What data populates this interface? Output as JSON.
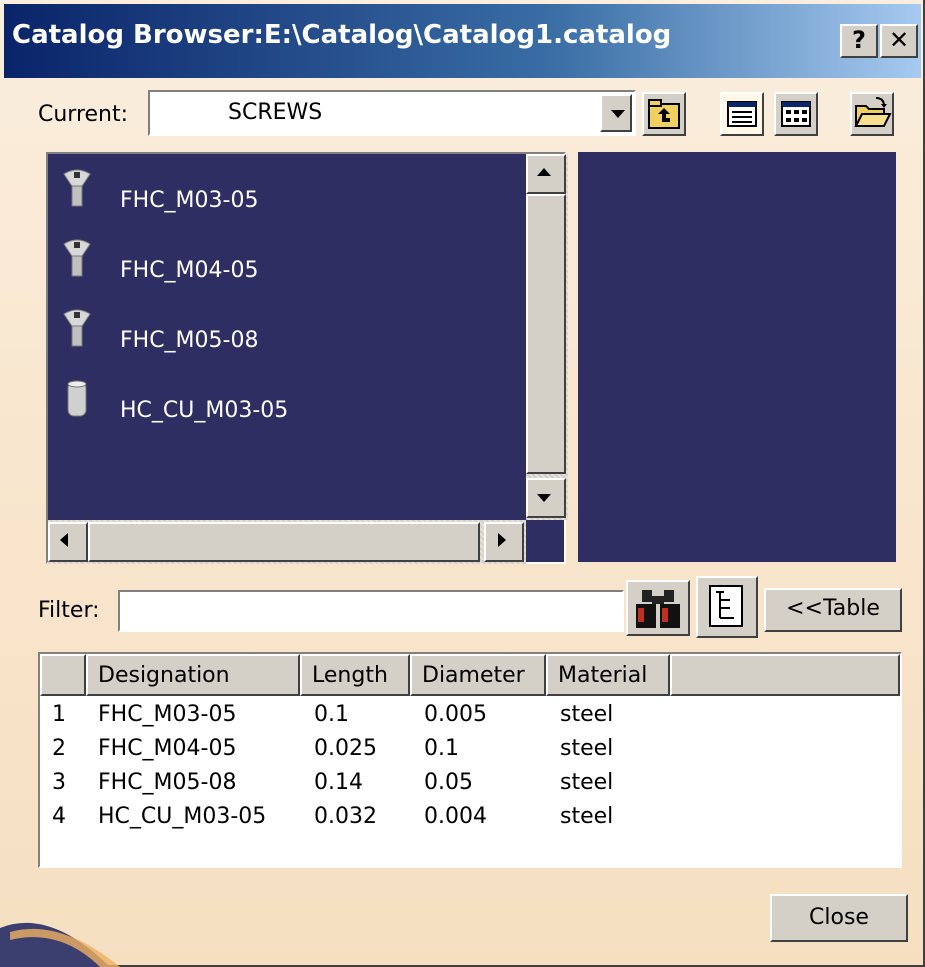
{
  "window": {
    "title": "Catalog Browser:E:\\Catalog\\Catalog1.catalog",
    "help_label": "?",
    "close_label": "✕"
  },
  "current": {
    "label": "Current:",
    "value": "SCREWS"
  },
  "icons": {
    "parent_chapter": "folder-up-icon",
    "list_view": "list-view-icon",
    "detail_view": "detail-view-icon",
    "open_catalog": "open-folder-icon",
    "search": "binoculars-icon",
    "tree": "tree-icon"
  },
  "list": {
    "items": [
      {
        "label": "FHC_M03-05",
        "icon": "screw-icon"
      },
      {
        "label": "FHC_M04-05",
        "icon": "screw-icon"
      },
      {
        "label": "FHC_M05-08",
        "icon": "screw-icon"
      },
      {
        "label": "HC_CU_M03-05",
        "icon": "cylinder-icon"
      }
    ]
  },
  "filter": {
    "label": "Filter:",
    "value": "",
    "table_button": "<<Table"
  },
  "table": {
    "columns": [
      "",
      "Designation",
      "Length",
      "Diameter",
      "Material"
    ],
    "rows": [
      [
        "1",
        "FHC_M03-05",
        "0.1",
        "0.005",
        "steel"
      ],
      [
        "2",
        "FHC_M04-05",
        "0.025",
        "0.1",
        "steel"
      ],
      [
        "3",
        "FHC_M05-08",
        "0.14",
        "0.05",
        "steel"
      ],
      [
        "4",
        "HC_CU_M03-05",
        "0.032",
        "0.004",
        "steel"
      ]
    ]
  },
  "footer": {
    "close_button": "Close"
  },
  "colors": {
    "list_background": "#2f2e63",
    "dialog_background": "#f9e7d0",
    "title_gradient_start": "#0a246a"
  }
}
